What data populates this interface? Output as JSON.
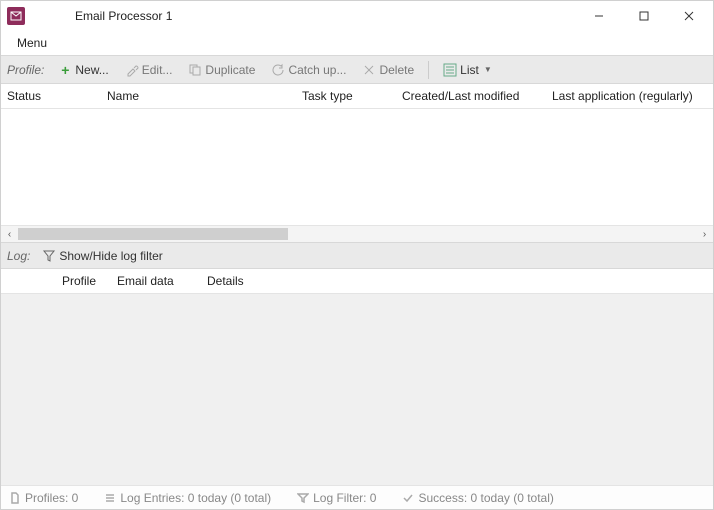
{
  "window": {
    "title": "Email Processor 1"
  },
  "menu": {
    "menu1": "Menu"
  },
  "toolbar": {
    "label": "Profile:",
    "new": "New...",
    "edit": "Edit...",
    "duplicate": "Duplicate",
    "catchup": "Catch up...",
    "delete": "Delete",
    "view": "List"
  },
  "profile_columns": {
    "status": "Status",
    "name": "Name",
    "task_type": "Task type",
    "created": "Created/Last modified",
    "last_app": "Last application (regularly)"
  },
  "logbar": {
    "label": "Log:",
    "toggle": "Show/Hide log filter"
  },
  "log_columns": {
    "blank": "",
    "profile": "Profile",
    "email_data": "Email data",
    "details": "Details"
  },
  "status": {
    "profiles": "Profiles: 0",
    "log_entries": "Log Entries: 0 today (0 total)",
    "log_filter": "Log Filter: 0",
    "success": "Success: 0 today (0 total)"
  }
}
